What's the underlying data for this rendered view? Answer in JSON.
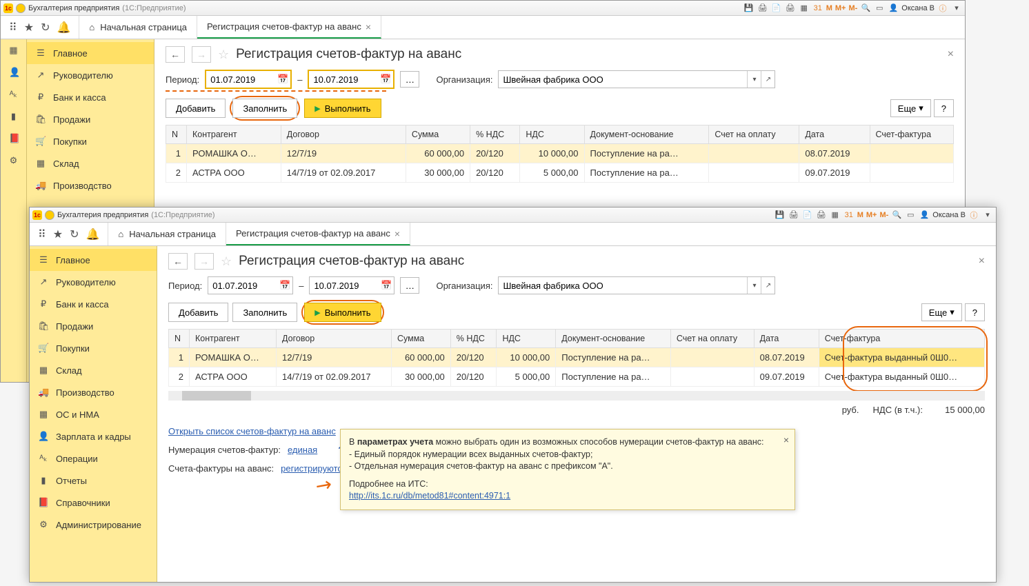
{
  "app_title": "Бухгалтерия предприятия",
  "app_subtitle": "(1С:Предприятие)",
  "user_label": "Оксана В",
  "tb_memory": [
    "M",
    "M+",
    "M-"
  ],
  "tabs": {
    "home": "Начальная страница",
    "doc": "Регистрация счетов-фактур на аванс"
  },
  "sidebar": {
    "items": [
      {
        "icon": "☰",
        "label": "Главное"
      },
      {
        "icon": "↗",
        "label": "Руководителю"
      },
      {
        "icon": "₽",
        "label": "Банк и касса"
      },
      {
        "icon": "🛍",
        "label": "Продажи"
      },
      {
        "icon": "🛒",
        "label": "Покупки"
      },
      {
        "icon": "▦",
        "label": "Склад"
      },
      {
        "icon": "🚚",
        "label": "Производство"
      },
      {
        "icon": "▦",
        "label": "ОС и НМА"
      },
      {
        "icon": "👤",
        "label": "Зарплата и кадры"
      },
      {
        "icon": "ᴬₖ",
        "label": "Операции"
      },
      {
        "icon": "▮",
        "label": "Отчеты"
      },
      {
        "icon": "📕",
        "label": "Справочники"
      },
      {
        "icon": "⚙",
        "label": "Администрирование"
      }
    ]
  },
  "sidebar_narrow_extra": [
    {
      "icon": "👤"
    },
    {
      "icon": "ᴬₖ"
    },
    {
      "icon": "▮"
    },
    {
      "icon": "📕"
    },
    {
      "icon": "⚙"
    }
  ],
  "page_title": "Регистрация счетов-фактур на аванс",
  "period_label": "Период:",
  "period_from": "01.07.2019",
  "period_sep": "–",
  "period_to": "10.07.2019",
  "org_label": "Организация:",
  "org_value": "Швейная фабрика ООО",
  "buttons": {
    "add": "Добавить",
    "fill": "Заполнить",
    "run": "Выполнить",
    "more": "Еще",
    "help": "?"
  },
  "cols": {
    "n": "N",
    "contr": "Контрагент",
    "dogovor": "Договор",
    "sum": "Сумма",
    "vatrate": "% НДС",
    "vat": "НДС",
    "docbase": "Документ-основание",
    "bill": "Счет на оплату",
    "date": "Дата",
    "sf": "Счет-фактура"
  },
  "rows1": [
    {
      "n": "1",
      "contr": "РОМАШКА О…",
      "dog": "12/7/19",
      "sum": "60 000,00",
      "rate": "20/120",
      "vat": "10 000,00",
      "doc": "Поступление на ра…",
      "bill": "",
      "date": "08.07.2019",
      "sf": ""
    },
    {
      "n": "2",
      "contr": "АСТРА ООО",
      "dog": "14/7/19 от 02.09.2017",
      "sum": "30 000,00",
      "rate": "20/120",
      "vat": "5 000,00",
      "doc": "Поступление на ра…",
      "bill": "",
      "date": "09.07.2019",
      "sf": ""
    }
  ],
  "rows2": [
    {
      "n": "1",
      "contr": "РОМАШКА О…",
      "dog": "12/7/19",
      "sum": "60 000,00",
      "rate": "20/120",
      "vat": "10 000,00",
      "doc": "Поступление на ра…",
      "bill": "",
      "date": "08.07.2019",
      "sf": "Счет-фактура выданный 0Ш0…"
    },
    {
      "n": "2",
      "contr": "АСТРА ООО",
      "dog": "14/7/19 от 02.09.2017",
      "sum": "30 000,00",
      "rate": "20/120",
      "vat": "5 000,00",
      "doc": "Поступление на ра…",
      "bill": "",
      "date": "09.07.2019",
      "sf": "Счет-фактура выданный 0Ш0…"
    }
  ],
  "footer": {
    "open_list": "Открыть список счетов-фактур на аванс",
    "num_label": "Нумерация счетов-фактур:",
    "num_value": "единая",
    "sf_label": "Счета-фактуры на аванс:",
    "sf_value": "регистрируются всегда при получении аванса"
  },
  "totals": {
    "currency": "руб.",
    "vat_label": "НДС (в т.ч.):",
    "vat_value": "15 000,00"
  },
  "tooltip": {
    "line1a": "В ",
    "line1b": "параметрах учета",
    "line1c": " можно выбрать один из возможных способов нумерации счетов-фактур на аванс:",
    "line2": "- Единый порядок нумерации всех выданных счетов-фактур;",
    "line3": "- Отдельная нумерация счетов-фактур на аванс с префиксом \"А\".",
    "line4": "Подробнее на ИТС:",
    "link": "http://its.1c.ru/db/metod81#content:4971:1"
  }
}
